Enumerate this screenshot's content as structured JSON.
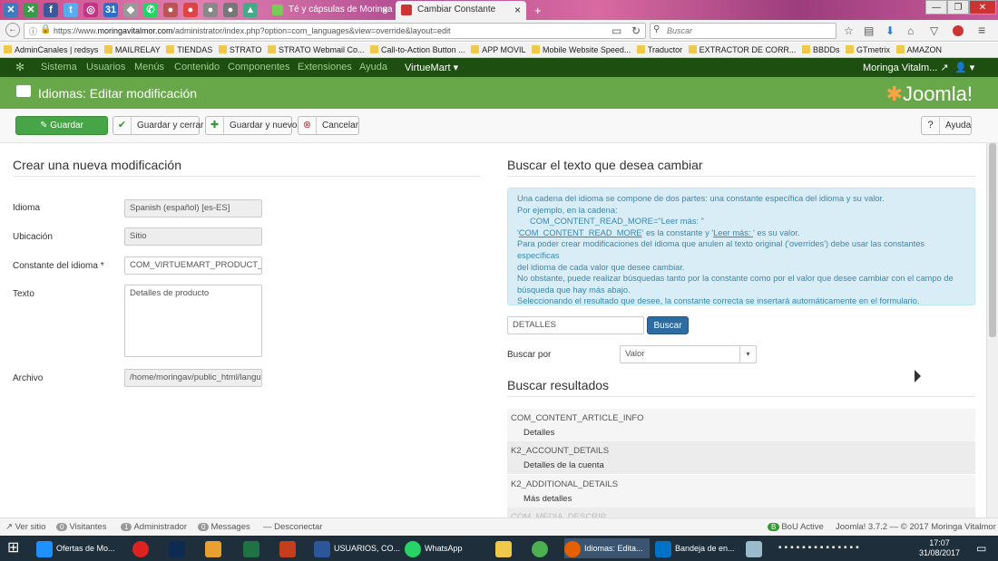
{
  "browser": {
    "tabs": [
      {
        "label": "Té y cápsulas de Moringa O",
        "active": false
      },
      {
        "label": "Cambiar Constante",
        "active": true
      }
    ],
    "url_prefix": "https://www.",
    "url_domain": "moringavitalmor.com",
    "url_rest": "/administrator/index.php?option=com_languages&view=override&layout=edit",
    "search_placeholder": "Buscar",
    "bookmarks": [
      "AdminCanales | redsys",
      "MAILRELAY",
      "TIENDAS",
      "STRATO",
      "STRATO Webmail Co...",
      "Call-to-Action Button ...",
      "APP MOVIL",
      "Mobile Website Speed...",
      "Traductor",
      "EXTRACTOR DE CORR...",
      "BBDDs",
      "GTmetrix",
      "AMAZON"
    ]
  },
  "jnav": {
    "items": [
      "Sistema",
      "Usuarios",
      "Menús",
      "Contenido",
      "Componentes",
      "Extensiones",
      "Ayuda"
    ],
    "virtuemart": "VirtueMart",
    "site": "Moringa Vitalm..."
  },
  "header": {
    "title": "Idiomas: Editar modificación",
    "logo": "Joomla!"
  },
  "toolbar": {
    "save": "Guardar",
    "save_close": "Guardar y cerrar",
    "save_new": "Guardar y nuevo",
    "cancel": "Cancelar",
    "help": "Ayuda"
  },
  "form": {
    "heading": "Crear una nueva modificación",
    "language_label": "Idioma",
    "language_value": "Spanish (español) [es-ES]",
    "location_label": "Ubicación",
    "location_value": "Sitio",
    "constant_label": "Constante del idioma *",
    "constant_value": "COM_VIRTUEMART_PRODUCT_DI",
    "text_label": "Texto",
    "text_value": "Detalles de producto",
    "file_label": "Archivo",
    "file_value": "/home/moringav/public_html/languag"
  },
  "search": {
    "heading": "Buscar el texto que desea cambiar",
    "info": {
      "l1": "Una cadena del idioma se compone de dos partes: una constante específica del idioma y su valor.",
      "l2": "Por ejemplo, en la cadena:",
      "l3": "COM_CONTENT_READ_MORE=\"Leer más: \"",
      "l4a": "'",
      "l4b": "COM_CONTENT_READ_MORE",
      "l4c": "' es la constante y '",
      "l4d": "Leer más: ",
      "l4e": "' es su valor.",
      "l5": "Para poder crear modificaciones del idioma que anulen al texto original ('overrides') debe usar las constantes específicas",
      "l6": "del idioma de cada valor que desee cambiar.",
      "l7": "No obstante, puede realizar búsquedas tanto por la constante como por el valor que desee cambiar con el campo de",
      "l8": "búsqueda que hay más abajo.",
      "l9": "Seleccionando el resultado que desee, la constante correcta se insertará automáticamente en el formulario."
    },
    "input_value": "DETALLES",
    "button": "Buscar",
    "search_by_label": "Buscar por",
    "search_by_value": "Valor",
    "results_heading": "Buscar resultados",
    "results": [
      {
        "key": "COM_CONTENT_ARTICLE_INFO",
        "value": "Detalles"
      },
      {
        "key": "K2_ACCOUNT_DETAILS",
        "value": "Detalles de la cuenta"
      },
      {
        "key": "K2_ADDITIONAL_DETAILS",
        "value": "Más detalles"
      },
      {
        "key": "COM_MEDIA_DESCRIP",
        "value": ""
      }
    ]
  },
  "status": {
    "view_site": "Ver sitio",
    "visitors_count": "0",
    "visitors": "Visitantes",
    "admin_count": "1",
    "admin": "Administrador",
    "messages_count": "0",
    "messages": "Messages",
    "logout": "Desconectar",
    "bou": "BoU Active",
    "version": "Joomla! 3.7.2 — © 2017 Moringa Vitalmor"
  },
  "taskbar": {
    "items": [
      "Ofertas de Mo...",
      "USUARIOS, CO...",
      "WhatsApp",
      "Idiomas: Edita...",
      "Bandeja de en..."
    ],
    "time": "17:07",
    "date": "31/08/2017"
  }
}
